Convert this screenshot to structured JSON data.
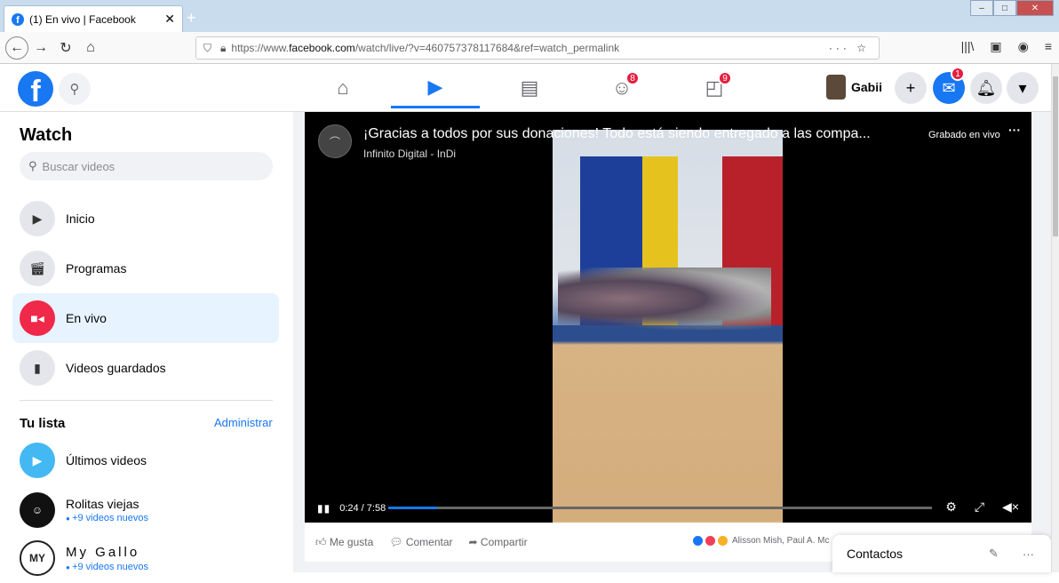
{
  "browser": {
    "tab_title": "(1) En vivo | Facebook",
    "tab_close": "✕",
    "new_tab": "+",
    "url_prefix": "https://www.",
    "url_domain": "facebook.com",
    "url_path": "/watch/live/?v=460757378117684&ref=watch_permalink",
    "url_actions": "··· ☆",
    "win_minimize": "–",
    "win_maximize": "□",
    "win_close": "✕"
  },
  "header": {
    "profile_name": "Gabii",
    "badges": {
      "groups": "8",
      "gaming": "9",
      "messenger": "1"
    }
  },
  "sidebar": {
    "title": "Watch",
    "search_placeholder": "Buscar videos",
    "items": [
      {
        "label": "Inicio"
      },
      {
        "label": "Programas"
      },
      {
        "label": "En vivo"
      },
      {
        "label": "Videos guardados"
      }
    ],
    "list_title": "Tu lista",
    "manage_label": "Administrar",
    "list_items": [
      {
        "label": "Últimos videos"
      },
      {
        "label": "Rolitas viejas",
        "sub": "+9 videos nuevos"
      },
      {
        "label": "My Gallo",
        "sub": "+9 videos nuevos"
      }
    ]
  },
  "video": {
    "title": "¡Gracias a todos por sus donaciones! Todo está siendo entregado a las compa...",
    "channel": "Infinito Digital - InDi",
    "status": "Grabado en vivo",
    "time": "0:24 / 7:58",
    "progress": 0.09
  },
  "actions": {
    "like": "Me gusta",
    "comment": "Comentar",
    "share": "Compartir",
    "reactors": "Alisson Mish, Paul A. Mc"
  },
  "contacts": {
    "title": "Contactos"
  },
  "colors": {
    "brand": "#1877f2",
    "badge": "#e41e3f",
    "live": "#f02849"
  }
}
